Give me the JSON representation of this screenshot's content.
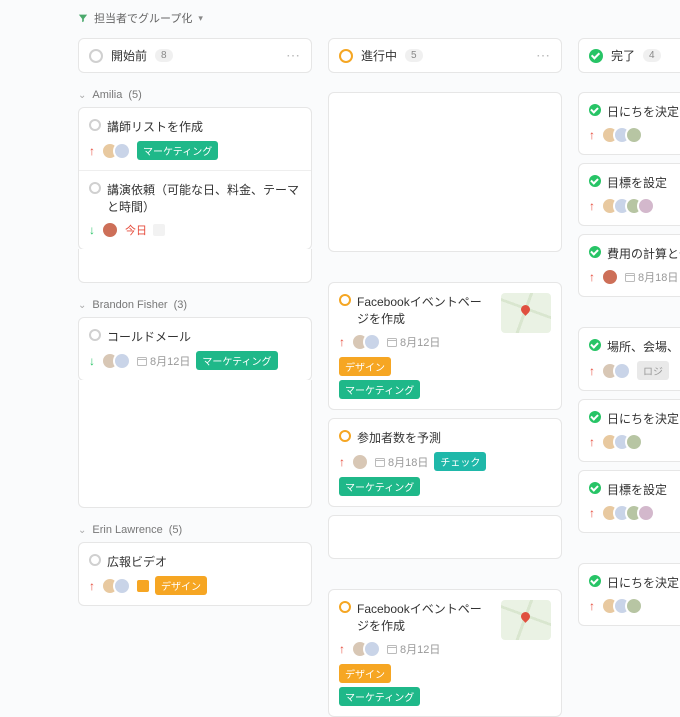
{
  "groupBy": {
    "label": "担当者でグループ化"
  },
  "columns": [
    {
      "key": "todo",
      "label": "開始前",
      "count": "8"
    },
    {
      "key": "progress",
      "label": "進行中",
      "count": "5"
    },
    {
      "key": "done",
      "label": "完了",
      "count": "4"
    }
  ],
  "sections": [
    {
      "name": "Amilia",
      "count": "(5)"
    },
    {
      "name": "Brandon Fisher",
      "count": "(3)"
    },
    {
      "name": "Erin Lawrence",
      "count": "(5)"
    }
  ],
  "cards": {
    "a1": {
      "title": "講師リストを作成",
      "tag": "マーケティング"
    },
    "a2": {
      "title": "講演依頼（可能な日、料金、テーマと時間）",
      "due": "今日"
    },
    "d1": {
      "title": "日にちを決定"
    },
    "d2": {
      "title": "目標を設定"
    },
    "d3": {
      "title": "費用の計算と予算",
      "due": "8月18日"
    },
    "b1": {
      "title": "コールドメール",
      "due": "8月12日",
      "tag": "マーケティング"
    },
    "p2": {
      "title": "Facebookイベントページを作成",
      "due": "8月12日",
      "tag1": "デザイン",
      "tag2": "マーケティング"
    },
    "p3": {
      "title": "参加者数を予測",
      "due": "8月18日",
      "tag1": "チェック",
      "tag2": "マーケティング"
    },
    "d4": {
      "title": "場所、会場、出店",
      "tag": "ロジ"
    },
    "d5": {
      "title": "日にちを決定"
    },
    "d6": {
      "title": "目標を設定"
    },
    "e1": {
      "title": "広報ビデオ",
      "tag": "デザイン"
    },
    "p4": {
      "title": "Facebookイベントページを作成",
      "due": "8月12日",
      "tag1": "デザイン",
      "tag2": "マーケティング"
    },
    "d7": {
      "title": "日にちを決定"
    }
  }
}
